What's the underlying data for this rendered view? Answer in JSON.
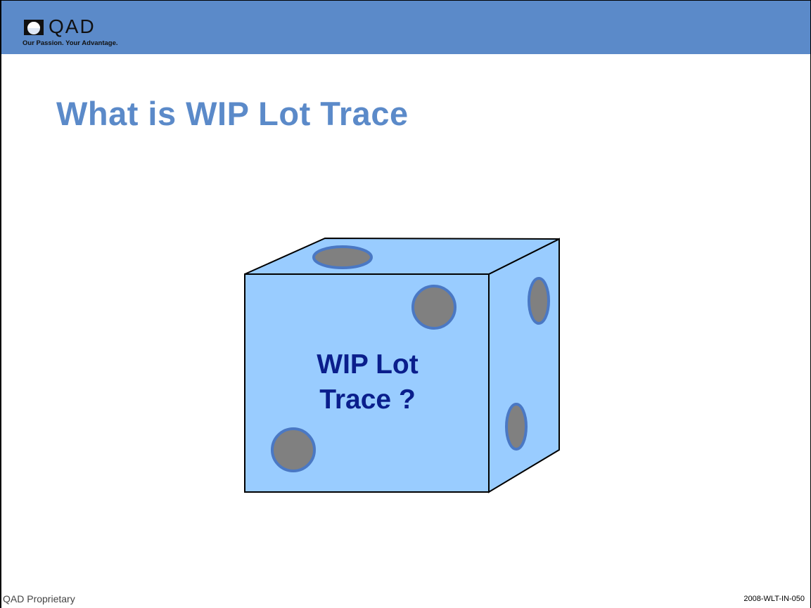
{
  "header": {
    "logo_word": "QAD",
    "logo_tagline": "Our Passion. Your Advantage.",
    "logo_icon": "qad-logo-icon",
    "bar_color": "#5b8ac9"
  },
  "slide": {
    "title": "What is WIP Lot Trace",
    "title_color": "#5b8ac9"
  },
  "cube": {
    "label_line1": "WIP Lot",
    "label_line2": "Trace ?",
    "label_color": "#0a1e8c",
    "face_color": "#99ccff",
    "dot_color": "#808080",
    "dot_ring_color": "#4a78c4"
  },
  "footer": {
    "left_text": "QAD Proprietary",
    "right_text": "2008-WLT-IN-050"
  }
}
